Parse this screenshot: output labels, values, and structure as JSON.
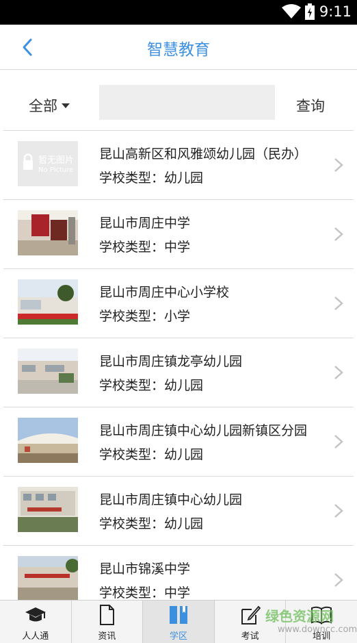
{
  "status_bar": {
    "time": "9:11"
  },
  "header": {
    "title": "智慧教育"
  },
  "filter": {
    "dropdown_label": "全部",
    "search_value": "",
    "query_label": "查询"
  },
  "schools": [
    {
      "name": "昆山高新区和风雅颂幼儿园（民办）",
      "type": "学校类型：幼儿园",
      "thumb": "no-picture",
      "no_picture_text": "暂无图片",
      "no_picture_en": "No Picture"
    },
    {
      "name": "昆山市周庄中学",
      "type": "学校类型：中学",
      "thumb": "photo-lobby"
    },
    {
      "name": "昆山市周庄中心小学校",
      "type": "学校类型：小学",
      "thumb": "photo-campus"
    },
    {
      "name": "昆山市周庄镇龙亭幼儿园",
      "type": "学校类型：幼儿园",
      "thumb": "photo-gate"
    },
    {
      "name": "昆山市周庄镇中心幼儿园新镇区分园",
      "type": "学校类型：幼儿园",
      "thumb": "photo-building"
    },
    {
      "name": "昆山市周庄镇中心幼儿园",
      "type": "学校类型：幼儿园",
      "thumb": "photo-facade"
    },
    {
      "name": "昆山市锦溪中学",
      "type": "学校类型：中学",
      "thumb": "photo-entrance"
    }
  ],
  "tabbar": [
    {
      "label": "人人通",
      "icon": "graduation-cap-icon",
      "active": false
    },
    {
      "label": "资讯",
      "icon": "document-icon",
      "active": false
    },
    {
      "label": "学区",
      "icon": "book-icon",
      "active": true
    },
    {
      "label": "考试",
      "icon": "edit-icon",
      "active": false
    },
    {
      "label": "培训",
      "icon": "open-book-icon",
      "active": false
    }
  ],
  "watermark": {
    "line1": "绿色资源网",
    "line2": "www.downcc.com"
  },
  "colors": {
    "accent": "#3d8fe0",
    "status_bar": "#000000",
    "tab_bar": "#f4f4f4"
  }
}
